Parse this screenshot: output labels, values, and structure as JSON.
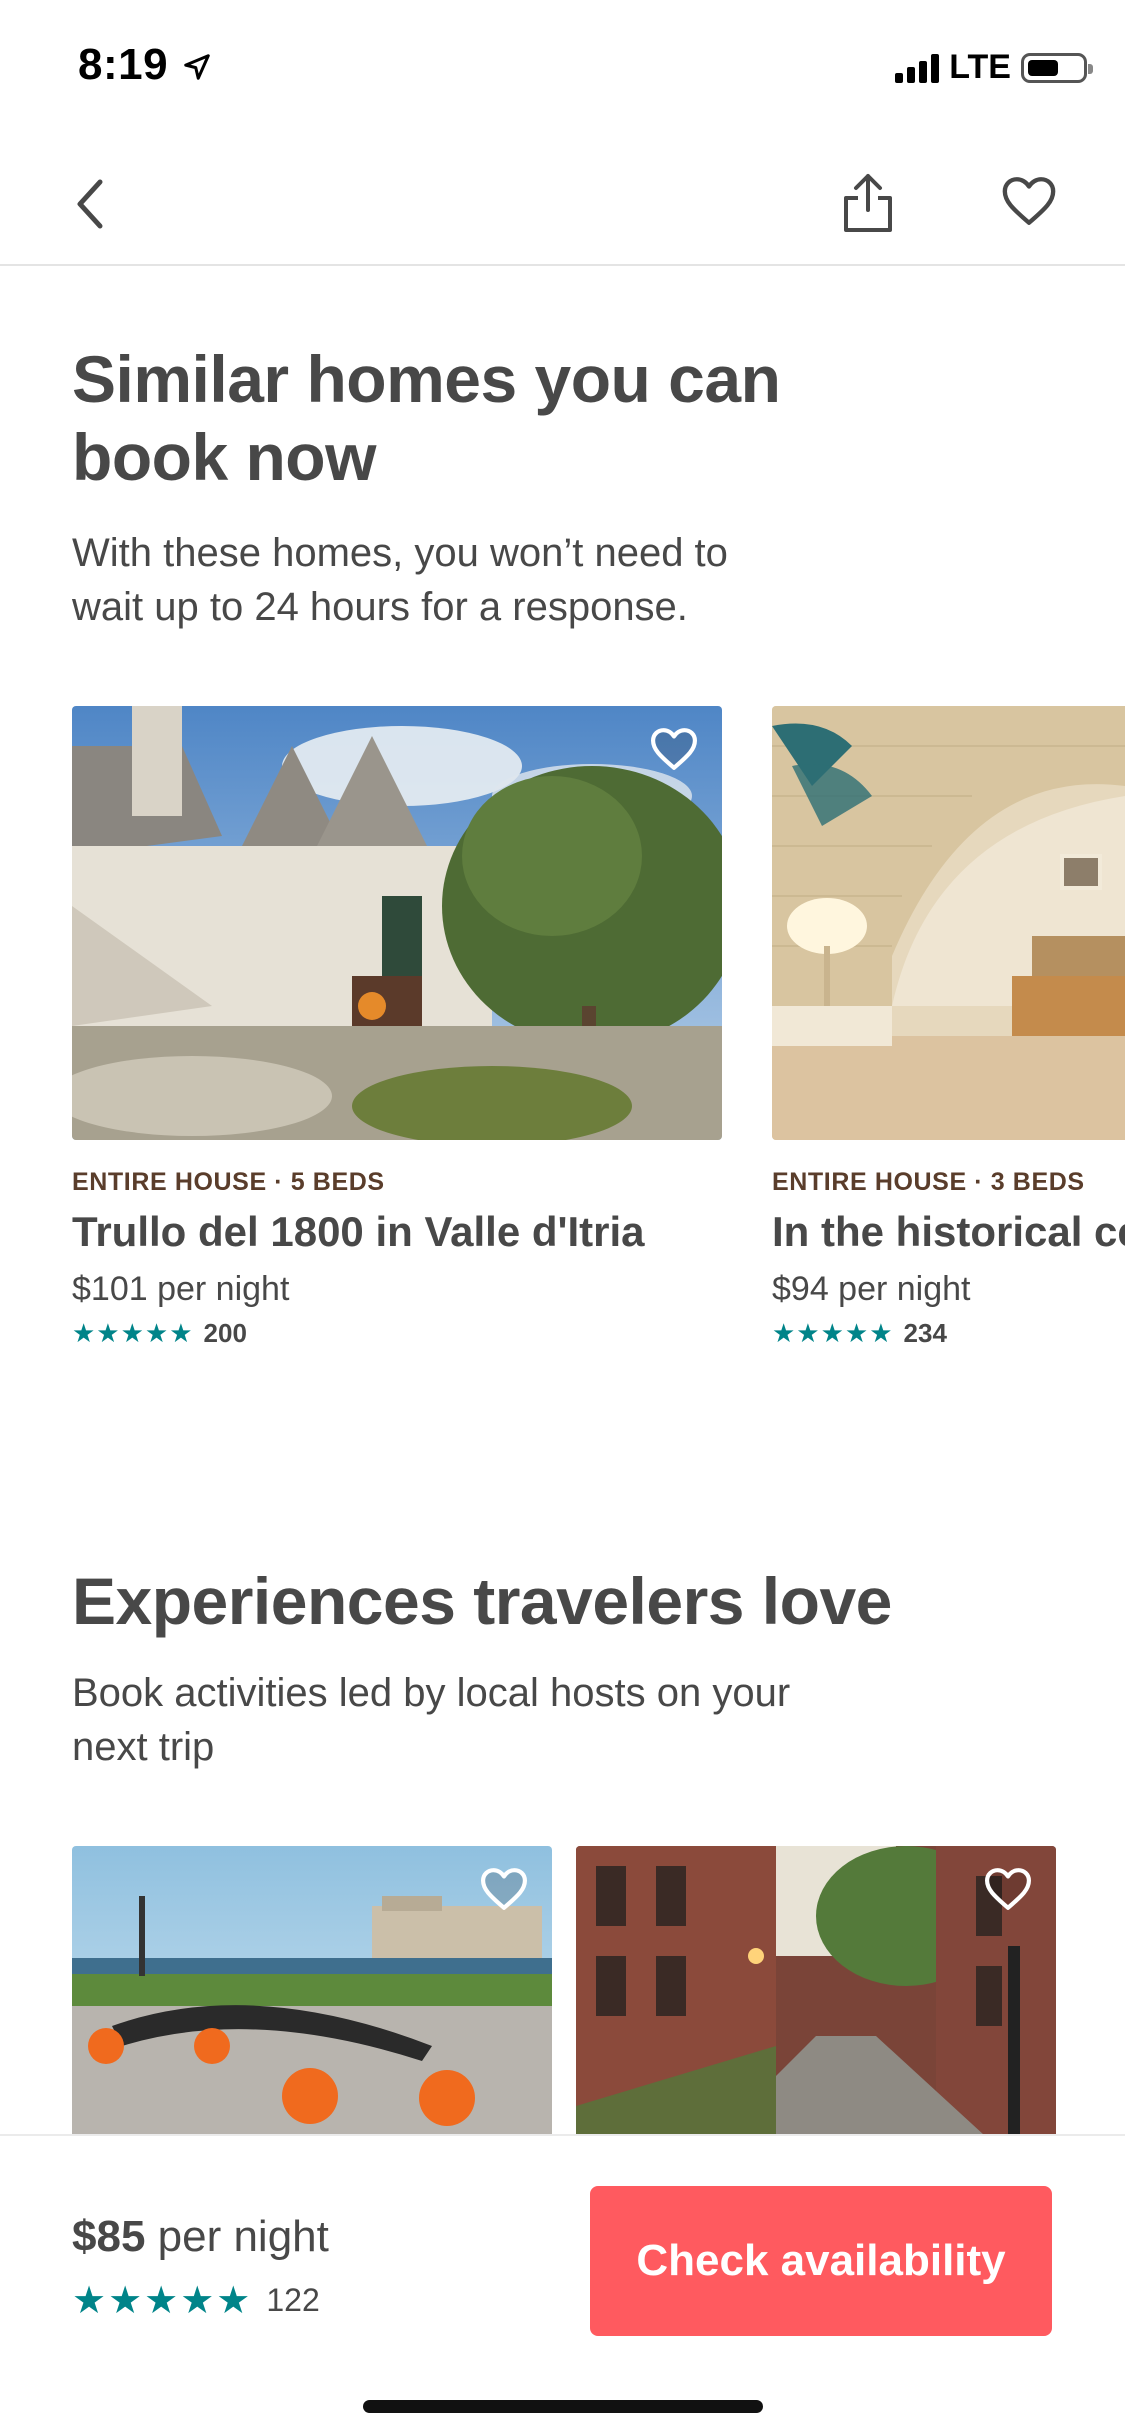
{
  "status_bar": {
    "time": "8:19",
    "network": "LTE"
  },
  "icons": {
    "back": "back-chevron-icon",
    "share": "share-icon",
    "save": "heart-icon",
    "location": "location-arrow-icon"
  },
  "similar_homes": {
    "title_line1": "Similar homes you can",
    "title_line2": "book now",
    "subtitle_line1": "With these homes, you won’t need to",
    "subtitle_line2": "wait up to 24 hours for a response.",
    "listings": [
      {
        "kicker": "ENTIRE HOUSE · 5 BEDS",
        "title": "Trullo del 1800 in Valle d'Itria",
        "price": "$101 per night",
        "stars": "★★★★★",
        "rating": 4.5,
        "reviews": "200"
      },
      {
        "kicker": "ENTIRE HOUSE · 3 BEDS",
        "title": "In the historical ce",
        "price": "$94 per night",
        "stars": "★★★★★",
        "rating": 5,
        "reviews": "234"
      }
    ]
  },
  "experiences": {
    "title": "Experiences travelers love",
    "subtitle_line1": "Book activities led by local hosts on your",
    "subtitle_line2": "next trip"
  },
  "booking_bar": {
    "price_amount": "$85",
    "price_unit": " per night",
    "stars": "★★★★★",
    "reviews": "122",
    "cta_label": "Check availability"
  },
  "colors": {
    "accent": "#ff5a5f",
    "stars": "#008489",
    "text": "#484848",
    "kicker": "#5a3d2b"
  }
}
